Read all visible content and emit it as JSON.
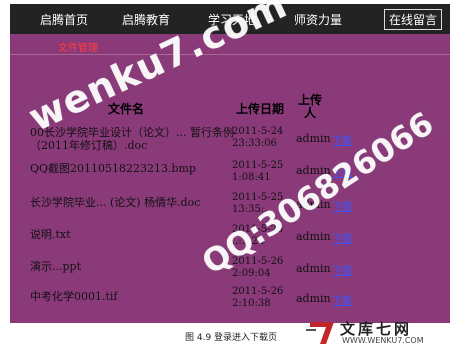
{
  "nav": {
    "items": [
      {
        "label": "启腾首页"
      },
      {
        "label": "启腾教育"
      },
      {
        "label": "学习天地"
      },
      {
        "label": "师资力量"
      },
      {
        "label": "在线留言"
      }
    ]
  },
  "panel": {
    "title": "文件管理",
    "headers": {
      "name": "文件名",
      "date": "上传日期",
      "uploader": "上传人"
    },
    "rows": [
      {
        "name": "00长沙学院毕业设计（论文）... 暂行条例（2011年修订稿）.doc",
        "date": "2011-5-24 23:33:06",
        "uploader": "admin",
        "download": "下载"
      },
      {
        "name": "QQ截图20110518223213.bmp",
        "date": "2011-5-25 1:08:41",
        "uploader": "admin",
        "download": "下载"
      },
      {
        "name": "长沙学院毕业... (论文) 杨倩华.doc",
        "date": "2011-5-25 13:35:..",
        "uploader": "admin",
        "download": "下载"
      },
      {
        "name": "说明.txt",
        "date": "2011-5-25 ..:..:24",
        "uploader": "admin",
        "download": "下载"
      },
      {
        "name": "演示...ppt",
        "date": "2011-5-26 2:09:04",
        "uploader": "admin",
        "download": "下载"
      },
      {
        "name": "中考化学0001.tif",
        "date": "2011-5-26 2:10:38",
        "uploader": "admin",
        "download": "下载"
      }
    ]
  },
  "caption": "图 4.9   登录进入下载页",
  "watermarks": {
    "site": "wenku7.com",
    "qq": "QQ:306826066"
  },
  "logo": {
    "text": "文库七网",
    "url": "WWW.WENKU7.COM",
    "accent": "#c0262a"
  },
  "colors": {
    "nav_bg": "#232323",
    "panel_bg": "#8a3a79",
    "title": "#ff3b3b",
    "link": "#3b55ff"
  }
}
